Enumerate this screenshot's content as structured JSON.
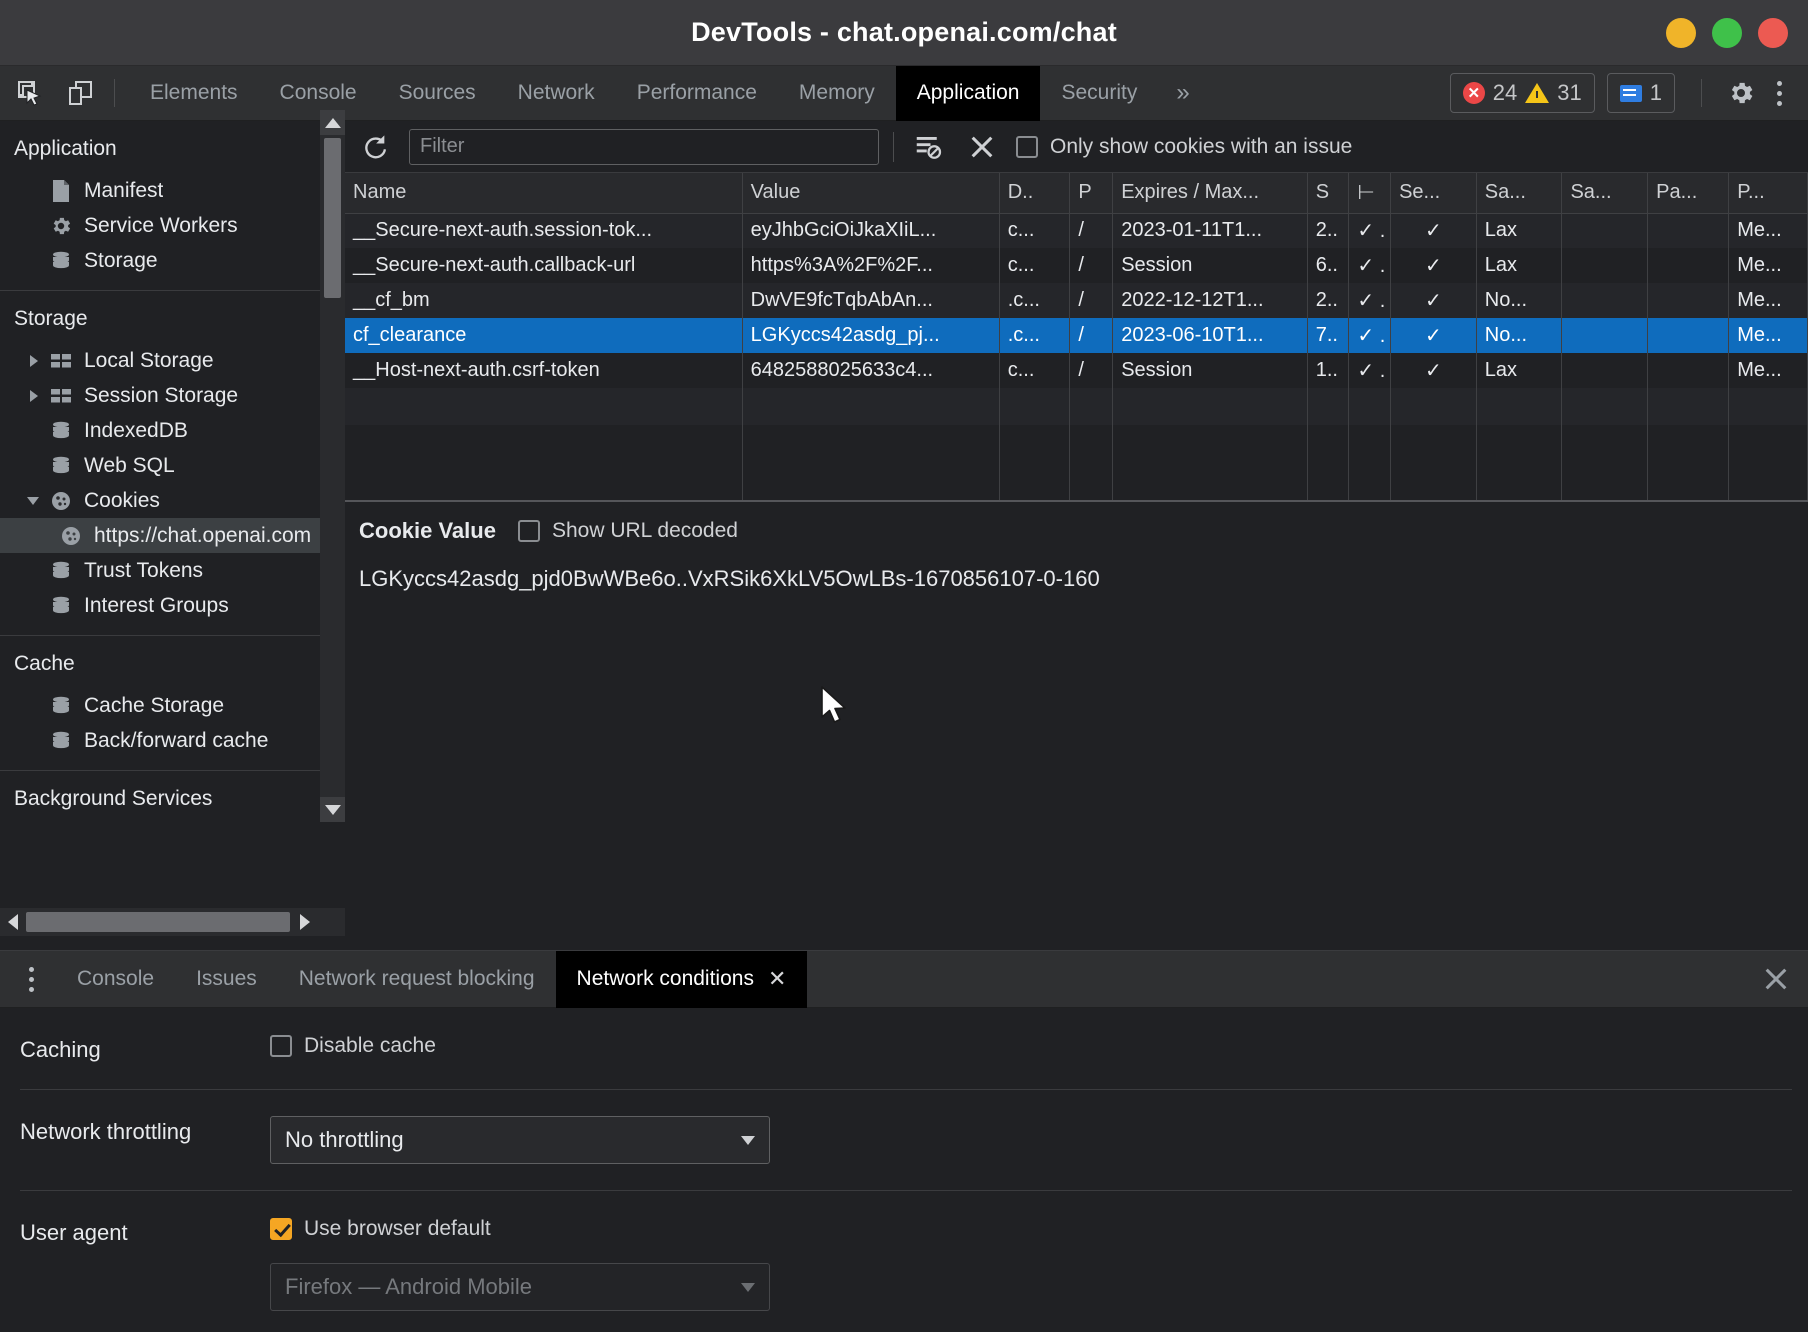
{
  "window": {
    "title": "DevTools - chat.openai.com/chat",
    "controls": [
      {
        "name": "minimize",
        "color": "#f0b429"
      },
      {
        "name": "maximize",
        "color": "#3fc14a"
      },
      {
        "name": "close",
        "color": "#ec5a52"
      }
    ]
  },
  "main_tabs": {
    "items": [
      {
        "label": "Elements",
        "active": false
      },
      {
        "label": "Console",
        "active": false
      },
      {
        "label": "Sources",
        "active": false
      },
      {
        "label": "Network",
        "active": false
      },
      {
        "label": "Performance",
        "active": false
      },
      {
        "label": "Memory",
        "active": false
      },
      {
        "label": "Application",
        "active": true
      },
      {
        "label": "Security",
        "active": false
      }
    ],
    "more_label": "»",
    "errors_count": "24",
    "warnings_count": "31",
    "messages_count": "1",
    "inspect_icon": "inspect-element-icon",
    "device_icon": "device-toolbar-icon",
    "settings_icon": "gear-icon",
    "menu_icon": "kebab-menu-icon"
  },
  "sidebar": {
    "sections": [
      {
        "title": "Application",
        "items": [
          {
            "label": "Manifest",
            "icon": "document-icon",
            "caret": "none",
            "indent": 1,
            "selected": false
          },
          {
            "label": "Service Workers",
            "icon": "gear-icon",
            "caret": "none",
            "indent": 1,
            "selected": false
          },
          {
            "label": "Storage",
            "icon": "database-icon",
            "caret": "none",
            "indent": 1,
            "selected": false
          }
        ]
      },
      {
        "title": "Storage",
        "items": [
          {
            "label": "Local Storage",
            "icon": "table-icon",
            "caret": "closed",
            "indent": 1,
            "selected": false
          },
          {
            "label": "Session Storage",
            "icon": "table-icon",
            "caret": "closed",
            "indent": 1,
            "selected": false
          },
          {
            "label": "IndexedDB",
            "icon": "database-icon",
            "caret": "none",
            "indent": 1,
            "selected": false
          },
          {
            "label": "Web SQL",
            "icon": "database-icon",
            "caret": "none",
            "indent": 1,
            "selected": false
          },
          {
            "label": "Cookies",
            "icon": "cookie-icon",
            "caret": "open",
            "indent": 1,
            "selected": false
          },
          {
            "label": "https://chat.openai.com",
            "icon": "cookie-icon",
            "caret": "none",
            "indent": 2,
            "selected": true
          },
          {
            "label": "Trust Tokens",
            "icon": "database-icon",
            "caret": "none",
            "indent": 1,
            "selected": false
          },
          {
            "label": "Interest Groups",
            "icon": "database-icon",
            "caret": "none",
            "indent": 1,
            "selected": false
          }
        ]
      },
      {
        "title": "Cache",
        "items": [
          {
            "label": "Cache Storage",
            "icon": "database-icon",
            "caret": "none",
            "indent": 1,
            "selected": false
          },
          {
            "label": "Back/forward cache",
            "icon": "database-icon",
            "caret": "none",
            "indent": 1,
            "selected": false
          }
        ]
      },
      {
        "title": "Background Services",
        "items": []
      }
    ]
  },
  "cookie_toolbar": {
    "refresh_icon": "refresh-icon",
    "filter_placeholder": "Filter",
    "filter_value": "",
    "clear_filtered_icon": "clear-filtered-cookies-icon",
    "clear_all_icon": "clear-all-cookies-icon",
    "issue_checkbox_label": "Only show cookies with an issue",
    "issue_checkbox_checked": false
  },
  "cookie_table": {
    "columns": [
      "Name",
      "Value",
      "D..",
      "P",
      "Expires / Max...",
      "S",
      "⊢",
      "Se...",
      "Sa...",
      "Sa...",
      "Pa...",
      "P..."
    ],
    "rows": [
      {
        "selected": false,
        "cells": [
          "__Secure-next-auth.session-tok...",
          "eyJhbGciOiJkaXIiL...",
          "c...",
          "/",
          "2023-01-11T1...",
          "2..",
          "✓ .",
          "✓",
          "Lax",
          "",
          "",
          "Me..."
        ]
      },
      {
        "selected": false,
        "cells": [
          "__Secure-next-auth.callback-url",
          "https%3A%2F%2F...",
          "c...",
          "/",
          "Session",
          "6..",
          "✓ .",
          "✓",
          "Lax",
          "",
          "",
          "Me..."
        ]
      },
      {
        "selected": false,
        "cells": [
          "__cf_bm",
          "DwVE9fcTqbAbAn...",
          ".c...",
          "/",
          "2022-12-12T1...",
          "2..",
          "✓ .",
          "✓",
          "No...",
          "",
          "",
          "Me..."
        ]
      },
      {
        "selected": true,
        "cells": [
          "cf_clearance",
          "LGKyccs42asdg_pj...",
          ".c...",
          "/",
          "2023-06-10T1...",
          "7..",
          "✓ .",
          "✓",
          "No...",
          "",
          "",
          "Me..."
        ]
      },
      {
        "selected": false,
        "cells": [
          "__Host-next-auth.csrf-token",
          "6482588025633c4...",
          "c...",
          "/",
          "Session",
          "1..",
          "✓ .",
          "✓",
          "Lax",
          "",
          "",
          "Me..."
        ]
      }
    ]
  },
  "cookie_value": {
    "title": "Cookie Value",
    "show_url_decoded_label": "Show URL decoded",
    "show_url_decoded_checked": false,
    "value": "LGKyccs42asdg_pjd0BwWBe6o..VxRSik6XkLV5OwLBs-1670856107-0-160"
  },
  "drawer": {
    "tabs": [
      {
        "label": "Console",
        "active": false,
        "closable": false
      },
      {
        "label": "Issues",
        "active": false,
        "closable": false
      },
      {
        "label": "Network request blocking",
        "active": false,
        "closable": false
      },
      {
        "label": "Network conditions",
        "active": true,
        "closable": true
      }
    ],
    "close_icon": "close-icon",
    "tab_close_glyph": "✕",
    "menu_icon": "kebab-menu-icon",
    "network_conditions": {
      "caching_label": "Caching",
      "disable_cache_label": "Disable cache",
      "disable_cache_checked": false,
      "throttling_label": "Network throttling",
      "throttling_value": "No throttling",
      "user_agent_label": "User agent",
      "use_browser_default_label": "Use browser default",
      "use_browser_default_checked": true,
      "user_agent_value": "Firefox — Android Mobile",
      "user_agent_disabled": true
    }
  },
  "colors": {
    "selection_blue": "#0f6cbd",
    "accent_orange": "#f5a623",
    "error_red": "#eb4747",
    "warning_yellow": "#f5c518",
    "info_blue": "#2f7de1"
  }
}
